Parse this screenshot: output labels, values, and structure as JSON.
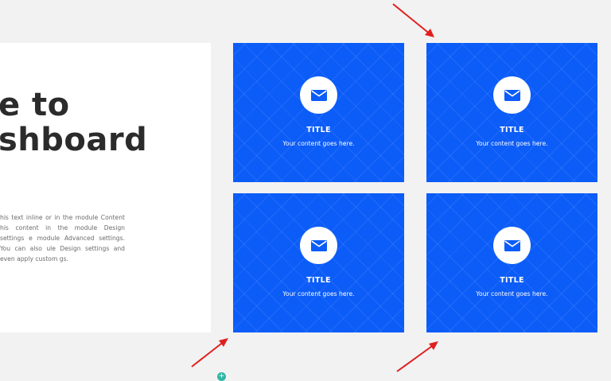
{
  "left_panel": {
    "heading_line1": "e to",
    "heading_line2": "shboard",
    "body_text": "his text inline or in the module Content his content in the module Design settings e module Advanced settings. You can also ule Design settings and even apply custom gs."
  },
  "cards": [
    {
      "title": "TITLE",
      "content": "Your content goes here.",
      "icon": "envelope-icon"
    },
    {
      "title": "TITLE",
      "content": "Your content goes here.",
      "icon": "envelope-icon"
    },
    {
      "title": "TITLE",
      "content": "Your content goes here.",
      "icon": "envelope-icon"
    },
    {
      "title": "TITLE",
      "content": "Your content goes here.",
      "icon": "envelope-icon"
    }
  ],
  "add_button": {
    "label": "+"
  },
  "colors": {
    "card_blue": "#0c5cf8",
    "page_bg": "#f2f2f2",
    "panel_bg": "#ffffff",
    "heading": "#2b2b2b",
    "arrow_red": "#e02020",
    "add_teal": "#2fb6a4"
  }
}
